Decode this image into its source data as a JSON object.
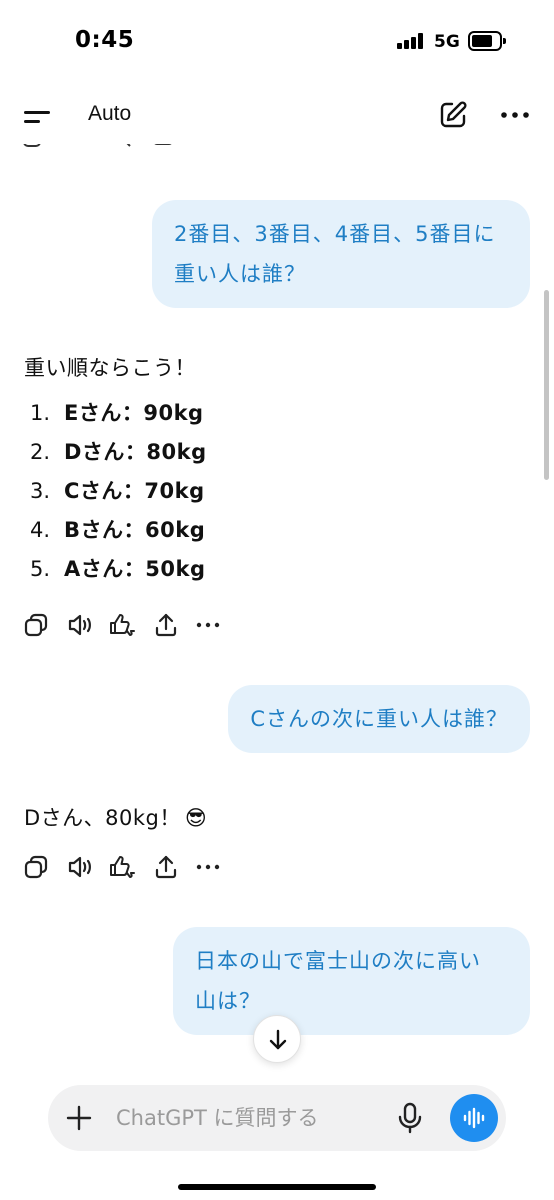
{
  "status_bar": {
    "time": "0:45",
    "network": "5G"
  },
  "header": {
    "model_label": "Auto"
  },
  "messages": [
    {
      "role": "user",
      "lines": [
        "2番目、3番目、4番目、5番目に",
        "重い人は誰？"
      ]
    },
    {
      "role": "assistant",
      "intro": "重い順ならこう！",
      "list": [
        {
          "num": "1.",
          "text": "Eさん：90kg"
        },
        {
          "num": "2.",
          "text": "Dさん：80kg"
        },
        {
          "num": "3.",
          "text": "Cさん：70kg"
        },
        {
          "num": "4.",
          "text": "Bさん：60kg"
        },
        {
          "num": "5.",
          "text": "Aさん：50kg"
        }
      ]
    },
    {
      "role": "user",
      "lines": [
        "Cさんの次に重い人は誰？"
      ]
    },
    {
      "role": "assistant",
      "text": "Dさん、80kg！",
      "emoji": "😎"
    },
    {
      "role": "user",
      "lines": [
        "日本の山で富士山の次に高い",
        "山は？"
      ]
    }
  ],
  "composer": {
    "placeholder": "ChatGPT に質問する"
  },
  "icons": {
    "menu": "menu-icon",
    "new_chat": "edit-icon",
    "more": "more-icon",
    "copy": "copy-icon",
    "read_aloud": "speaker-icon",
    "feedback": "thumbs-icon",
    "share": "share-icon",
    "scroll_down": "arrow-down-icon",
    "attach": "plus-icon",
    "dictate": "mic-icon",
    "voice_mode": "waveform-icon"
  },
  "colors": {
    "user_bubble_bg": "#e4f1fb",
    "user_bubble_text": "#1f7ec4",
    "voice_button": "#1f8ef0",
    "composer_bg": "#f1f1f2"
  }
}
